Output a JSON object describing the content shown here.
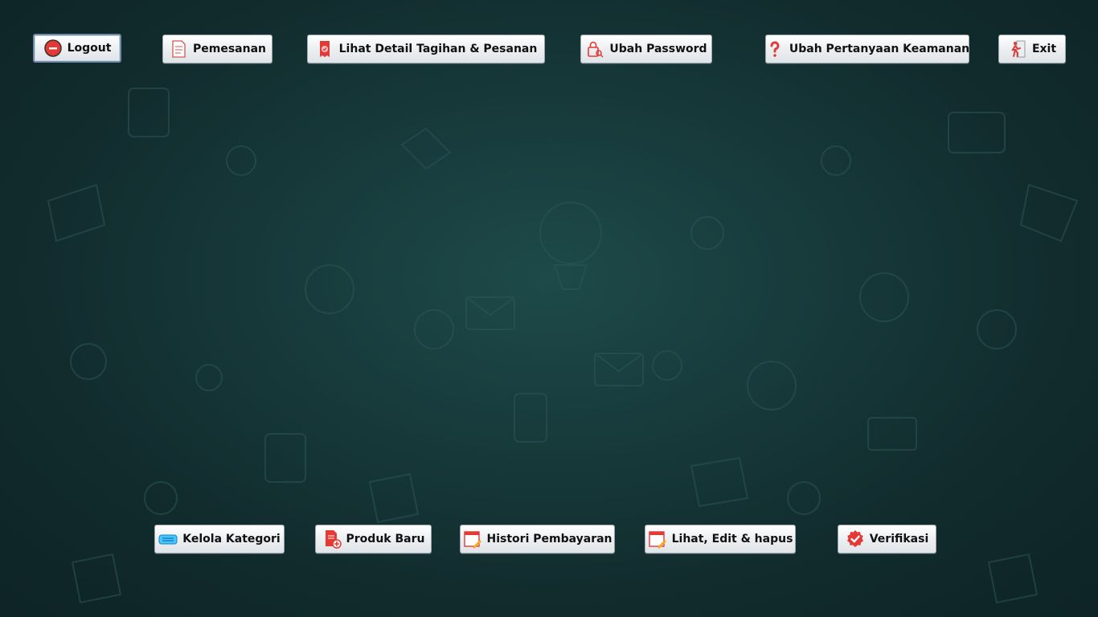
{
  "top_bar": {
    "logout_label": "Logout",
    "pemesanan_label": "Pemesanan",
    "detail_tagihan_label": "Lihat Detail Tagihan & Pesanan",
    "ubah_password_label": "Ubah Password",
    "ubah_pertanyaan_label": "Ubah Pertanyaan Keamanan",
    "exit_label": "Exit"
  },
  "bottom_bar": {
    "kelola_kategori_label": "Kelola Kategori",
    "produk_baru_label": "Produk Baru",
    "histori_pembayaran_label": "Histori Pembayaran",
    "lihat_edit_hapus_label": "Lihat, Edit & hapus",
    "verifikasi_label": "Verifikasi"
  },
  "icons": {
    "logout": "power-icon",
    "pemesanan": "document-icon",
    "detail_tagihan": "receipt-icon",
    "ubah_password": "lock-icon",
    "ubah_pertanyaan": "question-icon",
    "exit": "exit-door-icon",
    "kelola_kategori": "keyboard-icon",
    "produk_baru": "new-document-icon",
    "histori_pembayaran": "calendar-edit-icon",
    "lihat_edit_hapus": "calendar-edit-icon",
    "verifikasi": "check-badge-icon"
  },
  "colors": {
    "background": "#173a3b",
    "button_face": "#eef1f3",
    "accent_red": "#e53935"
  }
}
